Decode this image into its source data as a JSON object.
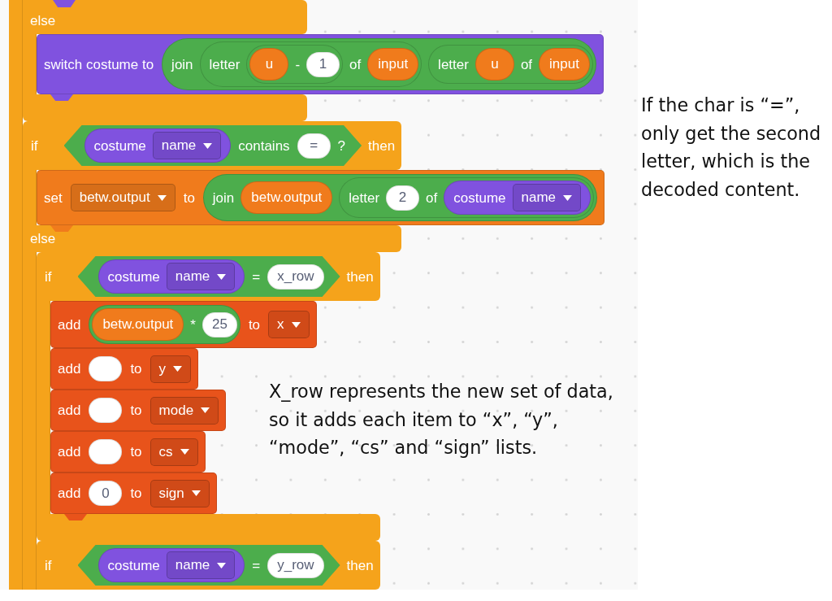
{
  "workspace": {
    "script": {
      "kind": "c_body",
      "color": "#f5a31b",
      "body": [
        {
          "kind": "else_tail",
          "color": "#f5a31b",
          "cut_block_above": {
            "color": "#8052df"
          },
          "else_label": "else",
          "closed": true,
          "else_body": [
            {
              "kind": "stack",
              "color": "#8052df",
              "parts": [
                {
                  "kind": "label",
                  "text": "switch costume to"
                },
                {
                  "kind": "reporter",
                  "color": "#4cad4c",
                  "parts": [
                    {
                      "kind": "label",
                      "text": "join"
                    },
                    {
                      "kind": "reporter",
                      "color": "#4cad4c",
                      "parts": [
                        {
                          "kind": "label",
                          "text": "letter"
                        },
                        {
                          "kind": "reporter",
                          "color": "#4cad4c",
                          "parts": [
                            {
                              "kind": "reporter",
                              "color": "#f07b1c",
                              "text": "u"
                            },
                            {
                              "kind": "label",
                              "text": "-"
                            },
                            {
                              "kind": "input",
                              "text": "1"
                            }
                          ]
                        },
                        {
                          "kind": "label",
                          "text": "of"
                        },
                        {
                          "kind": "reporter",
                          "color": "#f07b1c",
                          "text": "input"
                        }
                      ]
                    },
                    {
                      "kind": "reporter",
                      "color": "#4cad4c",
                      "parts": [
                        {
                          "kind": "label",
                          "text": "letter"
                        },
                        {
                          "kind": "reporter",
                          "color": "#f07b1c",
                          "text": "u"
                        },
                        {
                          "kind": "label",
                          "text": "of"
                        },
                        {
                          "kind": "reporter",
                          "color": "#f07b1c",
                          "text": "input"
                        }
                      ]
                    }
                  ]
                }
              ]
            }
          ]
        },
        {
          "kind": "if_else",
          "color": "#f5a31b",
          "header": [
            {
              "kind": "label",
              "text": "if"
            },
            {
              "kind": "boolean",
              "color": "#4cad4c",
              "parts": [
                {
                  "kind": "reporter",
                  "color": "#8052df",
                  "parts": [
                    {
                      "kind": "label",
                      "text": "costume"
                    },
                    {
                      "kind": "dropdown",
                      "text": "name"
                    }
                  ]
                },
                {
                  "kind": "label",
                  "text": "contains"
                },
                {
                  "kind": "input",
                  "text": "="
                },
                {
                  "kind": "label",
                  "text": "?"
                }
              ]
            },
            {
              "kind": "label",
              "text": "then"
            }
          ],
          "body": [
            {
              "kind": "stack",
              "color": "#f07b1c",
              "parts": [
                {
                  "kind": "label",
                  "text": "set"
                },
                {
                  "kind": "dropdown",
                  "text": "betw.output"
                },
                {
                  "kind": "label",
                  "text": "to"
                },
                {
                  "kind": "reporter",
                  "color": "#4cad4c",
                  "parts": [
                    {
                      "kind": "label",
                      "text": "join"
                    },
                    {
                      "kind": "reporter",
                      "color": "#f07b1c",
                      "text": "betw.output"
                    },
                    {
                      "kind": "reporter",
                      "color": "#4cad4c",
                      "parts": [
                        {
                          "kind": "label",
                          "text": "letter"
                        },
                        {
                          "kind": "input",
                          "text": "2"
                        },
                        {
                          "kind": "label",
                          "text": "of"
                        },
                        {
                          "kind": "reporter",
                          "color": "#8052df",
                          "parts": [
                            {
                              "kind": "label",
                              "text": "costume"
                            },
                            {
                              "kind": "dropdown",
                              "text": "name"
                            }
                          ]
                        }
                      ]
                    }
                  ]
                }
              ]
            }
          ],
          "else_label": "else",
          "else_body": [
            {
              "kind": "if",
              "color": "#f5a31b",
              "closed": true,
              "header": [
                {
                  "kind": "label",
                  "text": "if"
                },
                {
                  "kind": "boolean",
                  "color": "#4cad4c",
                  "parts": [
                    {
                      "kind": "reporter",
                      "color": "#8052df",
                      "parts": [
                        {
                          "kind": "label",
                          "text": "costume"
                        },
                        {
                          "kind": "dropdown",
                          "text": "name"
                        }
                      ]
                    },
                    {
                      "kind": "label",
                      "text": "="
                    },
                    {
                      "kind": "input",
                      "text": "x_row"
                    }
                  ]
                },
                {
                  "kind": "label",
                  "text": "then"
                }
              ],
              "body": [
                {
                  "kind": "stack",
                  "color": "#e8531b",
                  "parts": [
                    {
                      "kind": "label",
                      "text": "add"
                    },
                    {
                      "kind": "reporter",
                      "color": "#4cad4c",
                      "parts": [
                        {
                          "kind": "reporter",
                          "color": "#f07b1c",
                          "text": "betw.output"
                        },
                        {
                          "kind": "label",
                          "text": "*"
                        },
                        {
                          "kind": "input",
                          "text": "25"
                        }
                      ]
                    },
                    {
                      "kind": "label",
                      "text": "to"
                    },
                    {
                      "kind": "dropdown",
                      "text": "x"
                    }
                  ]
                },
                {
                  "kind": "stack",
                  "color": "#e8531b",
                  "parts": [
                    {
                      "kind": "label",
                      "text": "add"
                    },
                    {
                      "kind": "input"
                    },
                    {
                      "kind": "label",
                      "text": "to"
                    },
                    {
                      "kind": "dropdown",
                      "text": "y"
                    }
                  ]
                },
                {
                  "kind": "stack",
                  "color": "#e8531b",
                  "parts": [
                    {
                      "kind": "label",
                      "text": "add"
                    },
                    {
                      "kind": "input"
                    },
                    {
                      "kind": "label",
                      "text": "to"
                    },
                    {
                      "kind": "dropdown",
                      "text": "mode"
                    }
                  ]
                },
                {
                  "kind": "stack",
                  "color": "#e8531b",
                  "parts": [
                    {
                      "kind": "label",
                      "text": "add"
                    },
                    {
                      "kind": "input"
                    },
                    {
                      "kind": "label",
                      "text": "to"
                    },
                    {
                      "kind": "dropdown",
                      "text": "cs"
                    }
                  ]
                },
                {
                  "kind": "stack",
                  "color": "#e8531b",
                  "parts": [
                    {
                      "kind": "label",
                      "text": "add"
                    },
                    {
                      "kind": "input",
                      "text": "0"
                    },
                    {
                      "kind": "label",
                      "text": "to"
                    },
                    {
                      "kind": "dropdown",
                      "text": "sign"
                    }
                  ]
                }
              ]
            },
            {
              "kind": "if",
              "color": "#f5a31b",
              "header": [
                {
                  "kind": "label",
                  "text": "if"
                },
                {
                  "kind": "boolean",
                  "color": "#4cad4c",
                  "parts": [
                    {
                      "kind": "reporter",
                      "color": "#8052df",
                      "parts": [
                        {
                          "kind": "label",
                          "text": "costume"
                        },
                        {
                          "kind": "dropdown",
                          "text": "name"
                        }
                      ]
                    },
                    {
                      "kind": "label",
                      "text": "="
                    },
                    {
                      "kind": "input",
                      "text": "y_row"
                    }
                  ]
                },
                {
                  "kind": "label",
                  "text": "then"
                }
              ]
            }
          ]
        }
      ]
    },
    "note": "X_row represents the new set of data, so it adds each item to “x”, “y”, “mode”, “cs” and “sign” lists."
  },
  "side_note": "If the char is “=”, only get the second letter, which is the decoded content."
}
